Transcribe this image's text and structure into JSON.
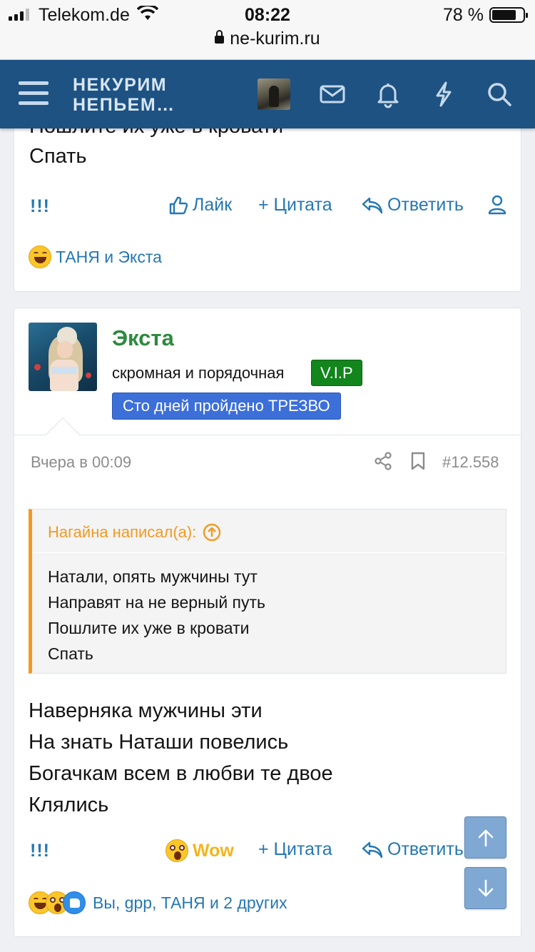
{
  "status_bar": {
    "carrier": "Telekom.de",
    "time": "08:22",
    "battery_text": "78 %",
    "battery_level": 0.78,
    "url": "ne-kurim.ru"
  },
  "navbar": {
    "logo_line1": "НЕКУРИМ",
    "logo_line2": "НЕПЬЕМ…",
    "icons": [
      "menu-icon",
      "avatar",
      "mail-icon",
      "bell-icon",
      "lightning-icon",
      "search-icon"
    ]
  },
  "prev_post": {
    "cut_line": "Пошлите их уже в кровати",
    "last_line": "Спать",
    "actions": {
      "excl": "!!!",
      "like": "Лайк",
      "quote": "+ Цитата",
      "reply": "Ответить"
    },
    "reactions_text": "ТАНЯ и Экста"
  },
  "post": {
    "username": "Экста",
    "user_title": "скромная и порядочная",
    "badge_vip": "V.I.P",
    "badge_sober": "Сто дней пройдено ТРЕЗВО",
    "date": "Вчера в 00:09",
    "number": "#12.558",
    "quote": {
      "author": "Нагайна написал(а):",
      "lines": [
        "Натали, опять мужчины тут",
        "Направят на не верный путь",
        "Пошлите их уже в кровати",
        "Спать"
      ]
    },
    "body_lines": [
      "Наверняка мужчины эти",
      "На знать Наташи повелись",
      "Богачкам всем в любви те двое",
      "Клялись"
    ],
    "actions": {
      "excl": "!!!",
      "wow": "Wow",
      "quote": "+ Цитата",
      "reply": "Ответить"
    },
    "reactions_text": "Вы, gpp, ТАНЯ и 2 других"
  },
  "colors": {
    "navbar": "#1d5283",
    "link": "#2577b1",
    "username": "#2d8a3e",
    "quote_accent": "#f09a23",
    "wow": "#f3b51c",
    "vip_badge": "#12851c",
    "sober_badge": "#3c6fd8"
  }
}
